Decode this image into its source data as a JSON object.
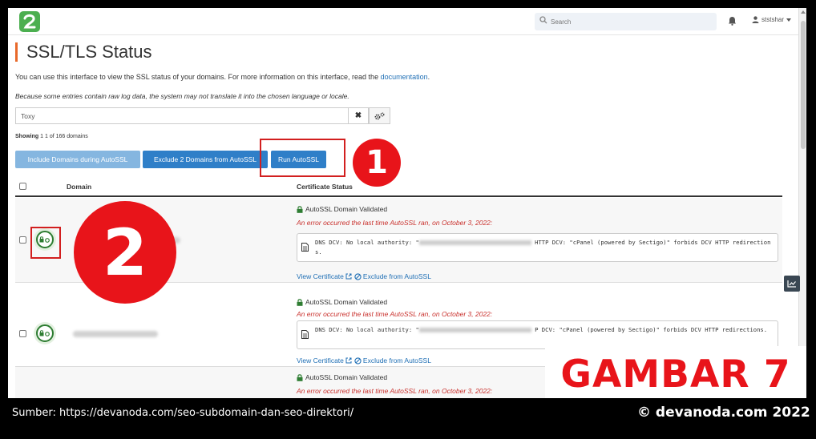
{
  "header": {
    "search_placeholder": "Search",
    "user_name": "ststshar"
  },
  "page": {
    "title": "SSL/TLS Status",
    "intro_text": "You can use this interface to view the SSL status of your domains. For more information on this interface, read the",
    "intro_link": "documentation",
    "intro_end": ".",
    "log_note": "Because some entries contain raw log data, the system may not translate it into the chosen language or locale."
  },
  "filter": {
    "value": "Toxy",
    "clear_label": "✖"
  },
  "showing": {
    "prefix": "Showing",
    "range": "1",
    "middle": "1 of",
    "total": "166 domains"
  },
  "buttons": {
    "include": "Include Domains during AutoSSL",
    "exclude": "Exclude 2 Domains from AutoSSL",
    "run": "Run AutoSSL"
  },
  "table": {
    "columns": [
      "Domain",
      "Certificate Status"
    ],
    "rows": [
      {
        "status": "AutoSSL Domain Validated",
        "error": "An error occurred the last time AutoSSL ran, on October 3, 2022:",
        "log_a": "DNS DCV: No local authority: \"",
        "log_b": "HTTP DCV: \"cPanel (powered by Sectigo)\" forbids DCV HTTP redirections.",
        "view_cert": "View Certificate",
        "exclude": "Exclude from AutoSSL",
        "domain_partial": "xyt"
      },
      {
        "status": "AutoSSL Domain Validated",
        "error": "An error occurred the last time AutoSSL ran, on October 3, 2022:",
        "log_a": "DNS DCV: No local authority: \"",
        "log_b": "P DCV: \"cPanel (powered by Sectigo)\" forbids DCV HTTP redirections.",
        "view_cert": "View Certificate",
        "exclude": "Exclude from AutoSSL"
      },
      {
        "status": "AutoSSL Domain Validated",
        "error": "An error occurred the last time AutoSSL ran, on October 3, 2022:"
      }
    ]
  },
  "annotations": {
    "step1": "1",
    "step2": "2",
    "gambar": "GAMBAR 7"
  },
  "footer": {
    "source": "Sumber:  https://devanoda.com/seo-subdomain-dan-seo-direktori/",
    "copyright": "© devanoda.com 2022"
  },
  "colors": {
    "accent": "#e8692a",
    "primary_button": "#2f7fc8",
    "light_button": "#85b6e0",
    "error": "#c9302c",
    "annotation_red": "#e8141a",
    "ssl_green": "#2e7d32"
  }
}
